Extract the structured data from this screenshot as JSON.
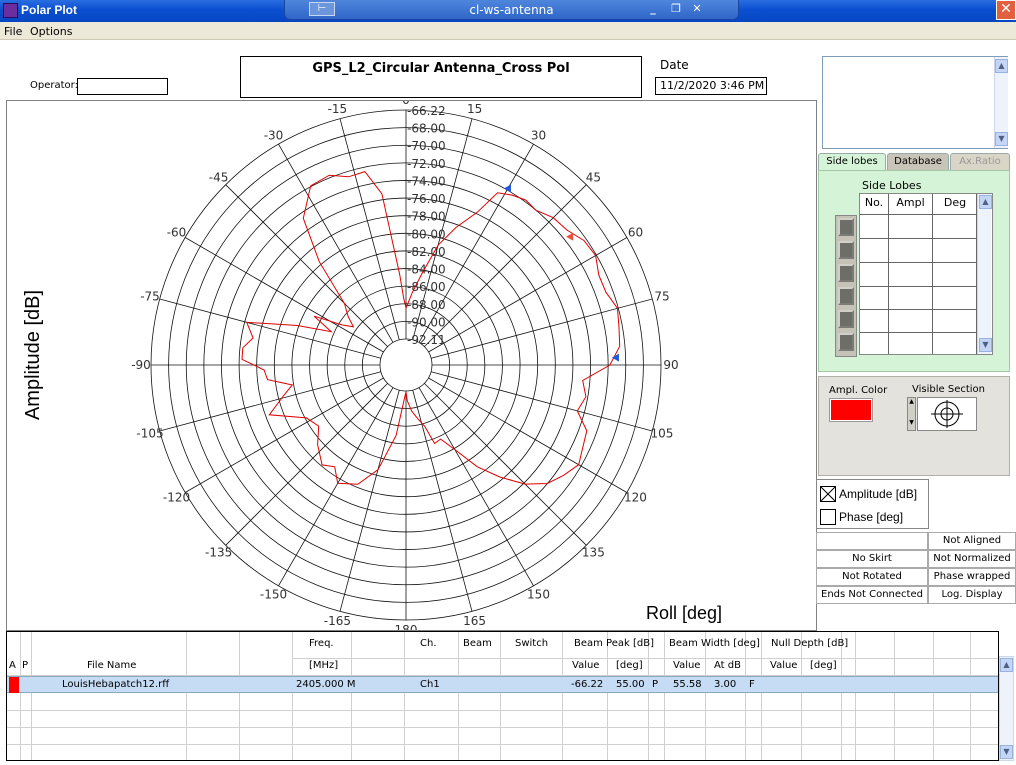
{
  "window": {
    "app_title": "Polar Plot",
    "remote_title": "cl-ws-antenna",
    "pin_glyph": "⊢",
    "min_glyph": "_",
    "restore_glyph": "❐",
    "close_glyph": "✕",
    "outer_close_glyph": "✕"
  },
  "menu": {
    "items": [
      "File",
      "Options"
    ]
  },
  "header": {
    "operator_label": "Operator:",
    "operator_value": "",
    "plot_title": "GPS_L2_Circular Antenna_Cross Pol",
    "date_label": "Date",
    "date_value": "11/2/2020 3:46 PM"
  },
  "plot": {
    "ylabel": "Amplitude [dB]",
    "xlabel": "Roll  [deg]",
    "trace_color": "#e00000",
    "marker_colors": [
      "#2255dd",
      "#e85040",
      "#2255dd"
    ]
  },
  "chart_data": {
    "type": "polar",
    "angle_ticks": [
      "0",
      "15",
      "30",
      "45",
      "60",
      "75",
      "90",
      "105",
      "120",
      "135",
      "150",
      "165",
      "180",
      "-165",
      "-150",
      "-135",
      "-120",
      "-105",
      "-90",
      "-75",
      "-60",
      "-45",
      "-30",
      "-15"
    ],
    "radial_ticks": [
      "-66.22",
      "-68.00",
      "-70.00",
      "-72.00",
      "-74.00",
      "-76.00",
      "-78.00",
      "-80.00",
      "-82.00",
      "-84.00",
      "-86.00",
      "-88.00",
      "-90.00",
      "-92.11"
    ],
    "r_range": [
      -92.11,
      -66.22
    ],
    "angle_range": [
      -180,
      180
    ],
    "grid": true,
    "series": [
      {
        "theta": [
          0,
          5,
          10,
          15,
          20,
          25,
          28,
          32,
          36,
          40,
          45,
          50,
          55,
          60,
          65,
          70,
          75,
          80,
          85,
          90,
          95,
          100,
          105,
          110,
          115,
          120,
          125,
          130,
          135,
          140,
          145,
          150,
          155,
          160,
          163,
          168,
          173,
          178,
          180,
          -178,
          -172,
          -165,
          -158,
          -150,
          -145,
          -140,
          -132,
          -125,
          -118,
          -110,
          -104,
          -100,
          -96,
          -92,
          -88,
          -84,
          -80,
          -75,
          -70,
          -66,
          -62,
          -58,
          -54,
          -50,
          -45,
          -40,
          -35,
          -28,
          -22,
          -17,
          -12,
          -8,
          -4,
          -2
        ],
        "r": [
          -88.6,
          -86.8,
          -84.5,
          -81.0,
          -78.5,
          -76.0,
          -73.0,
          -72.4,
          -72.0,
          -72.2,
          -71.5,
          -71.3,
          -70.5,
          -70.3,
          -71.0,
          -71.0,
          -70.3,
          -70.6,
          -70.8,
          -72.0,
          -75.0,
          -74.4,
          -75.0,
          -73.3,
          -73.0,
          -72.5,
          -73.3,
          -74.2,
          -76.0,
          -78.5,
          -81.0,
          -84.0,
          -85.8,
          -85.6,
          -87.8,
          -88.9,
          -89.8,
          -91.0,
          -92.0,
          -91.5,
          -87.0,
          -82.8,
          -80.5,
          -79.6,
          -81.0,
          -80.3,
          -81.6,
          -83.0,
          -82.3,
          -78.6,
          -80.8,
          -82.0,
          -79.3,
          -79.0,
          -76.5,
          -76.5,
          -77.5,
          -76.4,
          -82.0,
          -85.8,
          -83.3,
          -86.5,
          -87.7,
          -86.5,
          -85.2,
          -79.8,
          -74.8,
          -72.1,
          -71.9,
          -72.8,
          -72.7,
          -75.5,
          -84.8,
          -87.5
        ]
      }
    ],
    "markers": [
      {
        "theta": 30,
        "r": -72.0
      },
      {
        "theta": 52,
        "r": -71.5
      },
      {
        "theta": 88,
        "r": -71.3
      }
    ]
  },
  "notes_box": {
    "up_glyph": "▲",
    "down_glyph": "▼"
  },
  "tabs": [
    {
      "label": "Side lobes",
      "active": true
    },
    {
      "label": "Database",
      "active": false
    },
    {
      "label": "Ax.Ratio",
      "active": false
    }
  ],
  "side_lobes": {
    "title": "Side Lobes",
    "columns": [
      "No.",
      "Ampl",
      "Deg"
    ],
    "rows": []
  },
  "color_panel": {
    "ampl_color_label": "Ampl. Color",
    "ampl_color": "#ff0000",
    "visible_section_label": "Visible Section"
  },
  "legend": [
    {
      "label": "Amplitude [dB]",
      "checked": true
    },
    {
      "label": "Phase [deg]",
      "checked": false
    }
  ],
  "status": [
    [
      "",
      "Not Aligned"
    ],
    [
      "No Skirt",
      "Not Normalized"
    ],
    [
      "Not Rotated",
      "Phase wrapped"
    ],
    [
      "Ends Not Connected",
      "Log. Display"
    ]
  ],
  "table": {
    "headers": {
      "a": "A",
      "p": "P",
      "file_name": "File Name",
      "freq": "Freq.",
      "freq_unit": "[MHz]",
      "ch": "Ch.",
      "beam": "Beam",
      "switch": "Switch",
      "beam_peak": "Beam Peak [dB]",
      "bp_value": "Value",
      "bp_deg": "[deg]",
      "beam_width": "Beam Width [deg]",
      "bw_value": "Value",
      "bw_at": "At dB",
      "null_depth": "Null Depth [dB]",
      "nd_value": "Value",
      "nd_deg": "[deg]"
    },
    "rows": [
      {
        "file_name": "LouisHebapatch12.rff",
        "freq": "2405.000 M",
        "ch": "Ch1",
        "bp_value": "-66.22",
        "bp_deg": "55.00",
        "bp_flag": "P",
        "bw_value": "55.58",
        "bw_at": "3.00",
        "bw_flag": "F"
      }
    ],
    "scroll_up": "▲",
    "scroll_down": "▼"
  }
}
